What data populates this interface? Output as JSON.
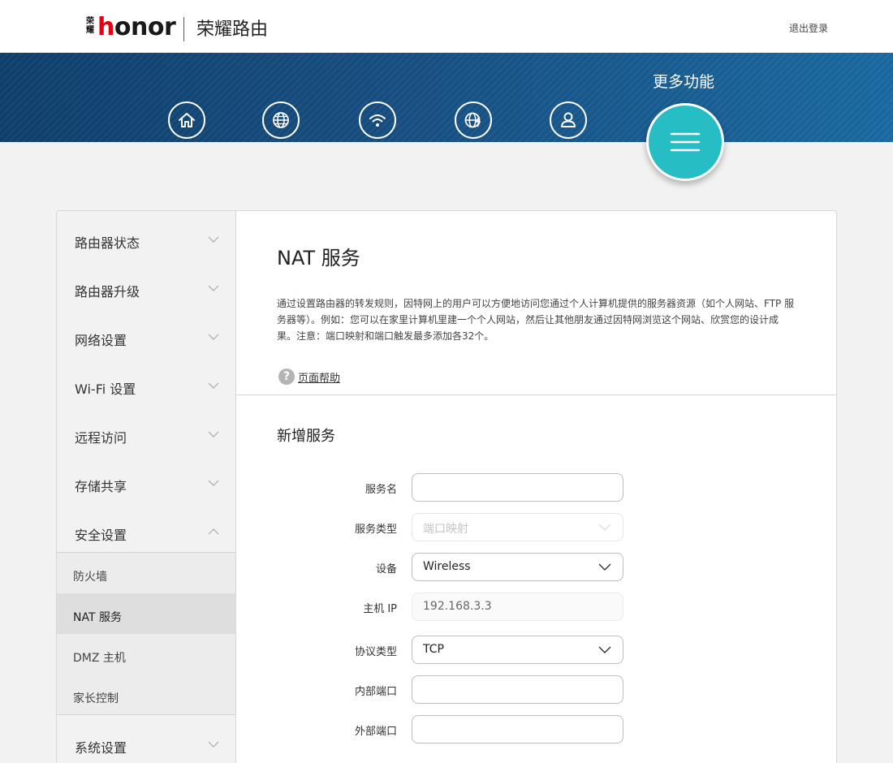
{
  "header": {
    "logo_cn": "荣耀",
    "logo_word_prefix": "h",
    "logo_word_rest": "onor",
    "product_title": "荣耀路由",
    "logout_label": "退出登录"
  },
  "banner": {
    "more_label": "更多功能",
    "nav_icons": [
      "home-icon",
      "globe-icon",
      "wifi-icon",
      "internet-status-icon",
      "user-icon"
    ],
    "menu_icon": "hamburger-menu-icon",
    "colors": {
      "banner_start": "#0f3f6d",
      "banner_end": "#1a6aa2",
      "accent": "#26bdc4"
    }
  },
  "sidebar": {
    "items": [
      {
        "label": "路由器状态",
        "expanded": false
      },
      {
        "label": "路由器升级",
        "expanded": false
      },
      {
        "label": "网络设置",
        "expanded": false
      },
      {
        "label": "Wi-Fi 设置",
        "expanded": false
      },
      {
        "label": "远程访问",
        "expanded": false
      },
      {
        "label": "存储共享",
        "expanded": false
      },
      {
        "label": "安全设置",
        "expanded": true
      },
      {
        "label": "系统设置",
        "expanded": false
      }
    ],
    "sub_items": [
      {
        "label": "防火墙",
        "active": false
      },
      {
        "label": "NAT 服务",
        "active": true
      },
      {
        "label": "DMZ 主机",
        "active": false
      },
      {
        "label": "家长控制",
        "active": false
      }
    ]
  },
  "main": {
    "title": "NAT 服务",
    "description": "通过设置路由器的转发规则，因特网上的用户可以方便地访问您通过个人计算机提供的服务器资源（如个人网站、FTP 服务器等）。例如：您可以在家里计算机里建一个个人网站，然后让其他朋友通过因特网浏览这个网站、欣赏您的设计成果。注意：端口映射和端口触发最多添加各32个。",
    "help_label": "页面帮助",
    "help_icon": "?",
    "section_title": "新增服务",
    "form": {
      "service_name": {
        "label": "服务名",
        "value": ""
      },
      "service_type": {
        "label": "服务类型",
        "value": "端口映射"
      },
      "device": {
        "label": "设备",
        "value": "Wireless"
      },
      "host_ip": {
        "label": "主机 IP",
        "value": "192.168.3.3"
      },
      "protocol": {
        "label": "协议类型",
        "value": "TCP"
      },
      "internal_port": {
        "label": "内部端口",
        "value": ""
      },
      "external_port": {
        "label": "外部端口",
        "value": ""
      }
    }
  }
}
